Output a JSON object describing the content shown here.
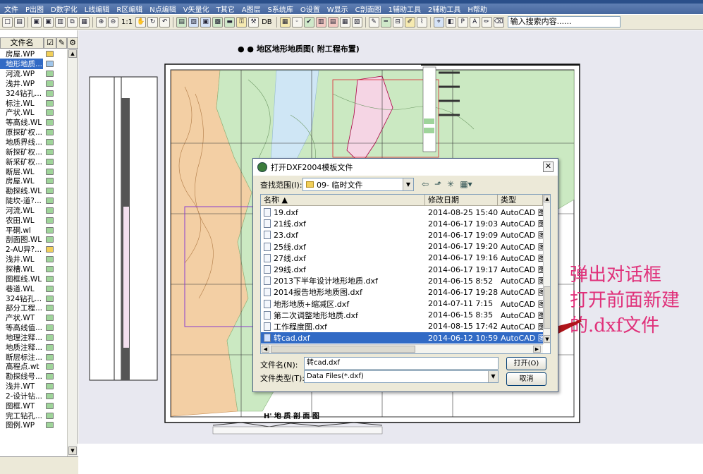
{
  "menu": [
    "文件",
    "P出图",
    "D数字化",
    "L线编辑",
    "R区编辑",
    "N点编辑",
    "V矢量化",
    "T其它",
    "A图层",
    "S系统库",
    "O设置",
    "W显示",
    "C剖面图",
    "1辅助工具",
    "2辅助工具",
    "H帮助"
  ],
  "toolbar": {
    "zoom_label": "1:1",
    "db_label": "DB",
    "search_text": "输入搜索内容......"
  },
  "file_panel": {
    "header_label": "文件名",
    "items": [
      {
        "name": "房屋.WP",
        "type": "folder"
      },
      {
        "name": "地形地质...",
        "type": "map",
        "selected": true
      },
      {
        "name": "河流.WP",
        "type": "layer"
      },
      {
        "name": "浅井.WP",
        "type": "layer"
      },
      {
        "name": "324钻孔...",
        "type": "layer"
      },
      {
        "name": "标注.WL",
        "type": "layer"
      },
      {
        "name": "产状.WL",
        "type": "layer"
      },
      {
        "name": "等高线.WL",
        "type": "layer"
      },
      {
        "name": "原探矿权...",
        "type": "layer"
      },
      {
        "name": "地质界线...",
        "type": "layer"
      },
      {
        "name": "新探矿权...",
        "type": "layer"
      },
      {
        "name": "新采矿权...",
        "type": "layer"
      },
      {
        "name": "断层.WL",
        "type": "layer"
      },
      {
        "name": "房屋.WL",
        "type": "layer"
      },
      {
        "name": "勘探线.WL",
        "type": "layer"
      },
      {
        "name": "陡坎-道?...",
        "type": "layer"
      },
      {
        "name": "河流.WL",
        "type": "layer"
      },
      {
        "name": "农田.WL",
        "type": "layer"
      },
      {
        "name": "平硐.wl",
        "type": "layer"
      },
      {
        "name": "剖面图.WL",
        "type": "layer"
      },
      {
        "name": "2-AU异?...",
        "type": "folder"
      },
      {
        "name": "浅井.WL",
        "type": "layer"
      },
      {
        "name": "探槽.WL",
        "type": "layer"
      },
      {
        "name": "图框线.WL",
        "type": "layer"
      },
      {
        "name": "巷道.WL",
        "type": "layer"
      },
      {
        "name": "324钻孔...",
        "type": "layer"
      },
      {
        "name": "部分工程...",
        "type": "layer"
      },
      {
        "name": "产状.WT",
        "type": "layer"
      },
      {
        "name": "等高线值...",
        "type": "layer"
      },
      {
        "name": "地理注释...",
        "type": "layer"
      },
      {
        "name": "地质注释...",
        "type": "layer"
      },
      {
        "name": "断层标注...",
        "type": "layer"
      },
      {
        "name": "高程点.wt",
        "type": "layer"
      },
      {
        "name": "勘探线号...",
        "type": "layer"
      },
      {
        "name": "浅井.WT",
        "type": "layer"
      },
      {
        "name": "2-设计钻...",
        "type": "layer"
      },
      {
        "name": "图框.WT",
        "type": "layer"
      },
      {
        "name": "完工钻孔...",
        "type": "layer"
      },
      {
        "name": "图例.WP",
        "type": "layer"
      }
    ]
  },
  "map": {
    "title": "● ● 地区地形地质图( 附工程布置)",
    "section_title": "H' 地 质 剖 面 图"
  },
  "dialog": {
    "title": "打开DXF2004模板文件",
    "look_in_label": "查找范围(I):",
    "look_in_value": "09- 临时文件",
    "columns": [
      "名称",
      "修改日期",
      "类型"
    ],
    "files": [
      {
        "name": "19.dxf",
        "date": "2014-08-25 15:40",
        "type": "AutoCAD 图形"
      },
      {
        "name": "21线.dxf",
        "date": "2014-06-17 19:03",
        "type": "AutoCAD 图形"
      },
      {
        "name": "23.dxf",
        "date": "2014-06-17 19:09",
        "type": "AutoCAD 图形"
      },
      {
        "name": "25线.dxf",
        "date": "2014-06-17 19:20",
        "type": "AutoCAD 图形"
      },
      {
        "name": "27线.dxf",
        "date": "2014-06-17 19:16",
        "type": "AutoCAD 图形"
      },
      {
        "name": "29线.dxf",
        "date": "2014-06-17 19:17",
        "type": "AutoCAD 图形"
      },
      {
        "name": "2013下半年设计地形地质.dxf",
        "date": "2014-06-15 8:52",
        "type": "AutoCAD 图形"
      },
      {
        "name": "2014报告地形地质图.dxf",
        "date": "2014-06-17 19:28",
        "type": "AutoCAD 图形"
      },
      {
        "name": "地形地质+缩减区.dxf",
        "date": "2014-07-11 7:15",
        "type": "AutoCAD 图形"
      },
      {
        "name": "第二次调整地形地质.dxf",
        "date": "2014-06-15 8:35",
        "type": "AutoCAD 图形"
      },
      {
        "name": "工作程度图.dxf",
        "date": "2014-08-15 17:42",
        "type": "AutoCAD 图形"
      },
      {
        "name": "转cad.dxf",
        "date": "2014-06-12 10:59",
        "type": "AutoCAD 图形",
        "selected": true
      }
    ],
    "filename_label": "文件名(N):",
    "filename_value": "转cad.dxf",
    "filetype_label": "文件类型(T):",
    "filetype_value": "Data Files(*.dxf)",
    "open_label": "打开(O)",
    "cancel_label": "取消"
  },
  "annotation": {
    "lines": [
      "弹出对话框",
      "打开前面新建",
      "的.dxf文件"
    ],
    "color": "#e0317a",
    "arrow_color": "#b0141a"
  }
}
